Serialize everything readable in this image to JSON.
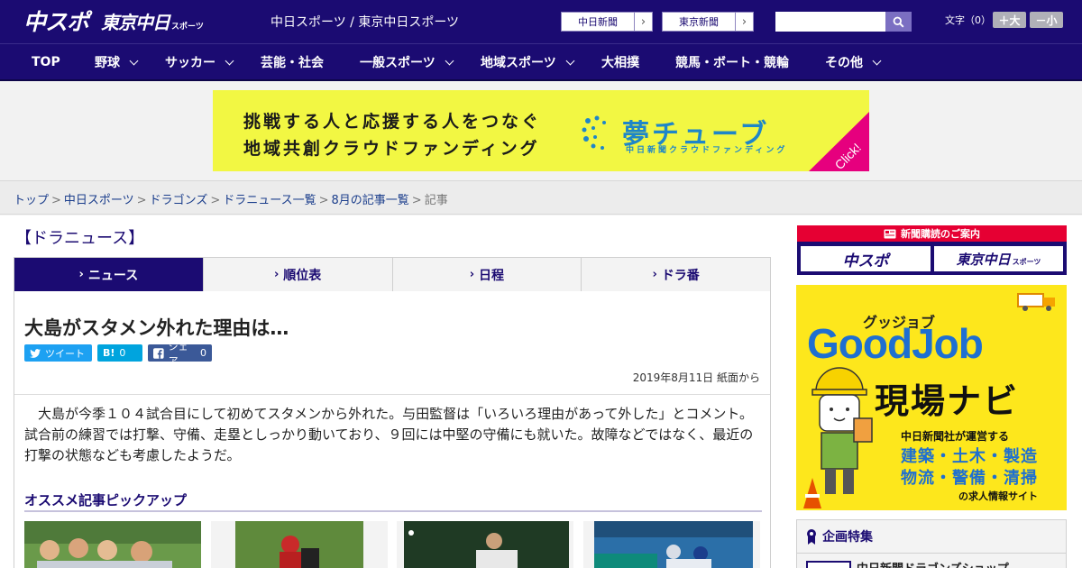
{
  "header": {
    "logo_primary": "中スポ",
    "logo_secondary": "東京中日",
    "logo_secondary_small": "スポーツ",
    "site_title": "中日スポーツ / 東京中日スポーツ",
    "paper_links": [
      "中日新聞",
      "東京新聞"
    ],
    "search_placeholder": "",
    "font_size_label": "文字（0）",
    "font_big": "＋大",
    "font_small": "－小"
  },
  "nav": {
    "items": [
      {
        "label": "TOP",
        "dropdown": false
      },
      {
        "label": "野球",
        "dropdown": true
      },
      {
        "label": "サッカー",
        "dropdown": true
      },
      {
        "label": "芸能・社会",
        "dropdown": false
      },
      {
        "label": "一般スポーツ",
        "dropdown": true
      },
      {
        "label": "地域スポーツ",
        "dropdown": true
      },
      {
        "label": "大相撲",
        "dropdown": false
      },
      {
        "label": "競馬・ボート・競輪",
        "dropdown": false
      },
      {
        "label": "その他",
        "dropdown": true
      }
    ]
  },
  "banner": {
    "line1": "挑戦する人と応援する人をつなぐ",
    "line2": "地域共創クラウドファンディング",
    "brand": "夢チューブ",
    "sub": "中日新聞クラウドファンディング",
    "click": "Click!",
    "bg_color": "#f2f743",
    "brand_color": "#1e86c8",
    "accent_color": "#e6007e"
  },
  "breadcrumb": {
    "links": [
      "トップ",
      "中日スポーツ",
      "ドラゴンズ",
      "ドラニュース一覧",
      "8月の記事一覧"
    ],
    "current": "記事",
    "separator": ">"
  },
  "section": {
    "title": "【ドラニュース】"
  },
  "tabs": [
    {
      "label": "ニュース",
      "active": true
    },
    {
      "label": "順位表",
      "active": false
    },
    {
      "label": "日程",
      "active": false
    },
    {
      "label": "ドラ番",
      "active": false
    }
  ],
  "article": {
    "title": "大島がスタメン外れた理由は…",
    "share": {
      "tweet_label": "ツイート",
      "hatena_icon": "B!",
      "hatena_count": "0",
      "facebook_label": "シェア",
      "facebook_count": "0"
    },
    "date": "2019年8月11日 紙面から",
    "body": "大島が今季１０４試合目にして初めてスタメンから外れた。与田監督は「いろいろ理由があって外した」とコメント。試合前の練習では打撃、守備、走塁としっかり動いており、９回には中堅の守備にも就いた。故障などではなく、最近の打撃の状態なども考慮したようだ。",
    "pickup_title": "オススメ記事ピックアップ"
  },
  "sidebar": {
    "subscribe": {
      "head": "新聞購読のご案内",
      "btn1": "中スポ",
      "btn2": "東京中日",
      "btn2_small": "スポーツ"
    },
    "goodjob": {
      "kana": "グッジョブ",
      "logo": "GoodJob",
      "navi": "現場ナビ",
      "line1": "中日新聞社が運営する",
      "line2": "建築・土木・製造",
      "line3": "物流・警備・清掃",
      "line4": "の求人情報サイト",
      "bg_color": "#fde71c",
      "logo_color": "#1e6fd1"
    },
    "kikaku": {
      "head": "企画特集",
      "item": "中日新聞ドラゴンズショップ"
    }
  },
  "colors": {
    "brand_navy": "#1b0b72",
    "link_blue": "#1b3e8c",
    "twitter": "#1da1f2",
    "hatena": "#00a4de",
    "facebook": "#3b5998",
    "subscribe_red": "#e60033"
  }
}
